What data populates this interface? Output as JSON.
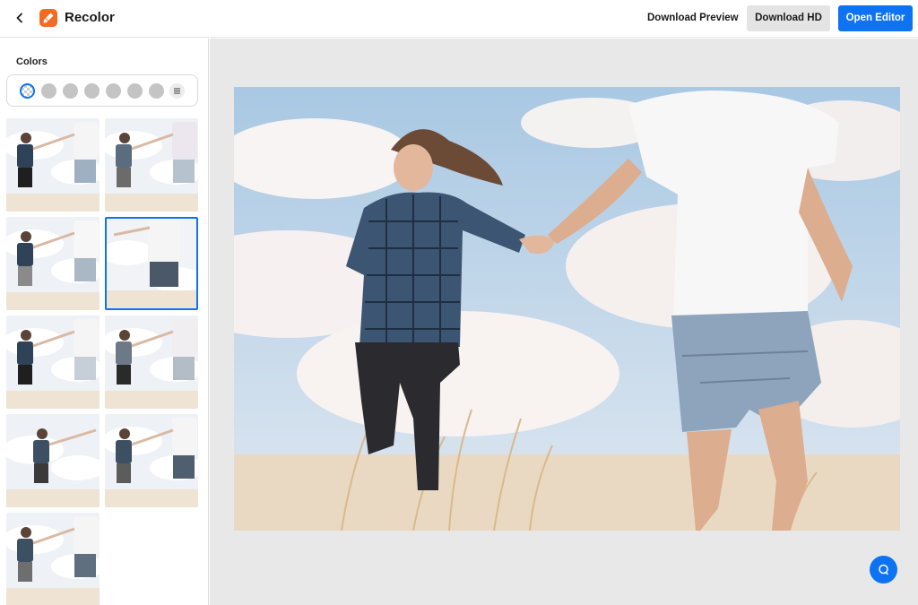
{
  "header": {
    "title": "Recolor",
    "back_icon": "chevron-left-icon",
    "logo_icon": "recolor-brush-icon",
    "download_preview_label": "Download Preview",
    "download_hd_label": "Download HD",
    "open_editor_label": "Open Editor"
  },
  "sidebar": {
    "colors_label": "Colors",
    "swatches": [
      "transparent",
      "#c4c4c4",
      "#c4c4c4",
      "#c4c4c4",
      "#c4c4c4",
      "#c4c4c4",
      "#c4c4c4"
    ],
    "settings_icon": "sliders-icon",
    "variations_count": 9,
    "selected_variation": 4
  },
  "canvas": {
    "image_subject": "couple-running-in-field-photo",
    "chat_icon": "chat-bubble-icon"
  },
  "colors": {
    "accent": "#0d73f2",
    "brand": "#f26b21"
  }
}
